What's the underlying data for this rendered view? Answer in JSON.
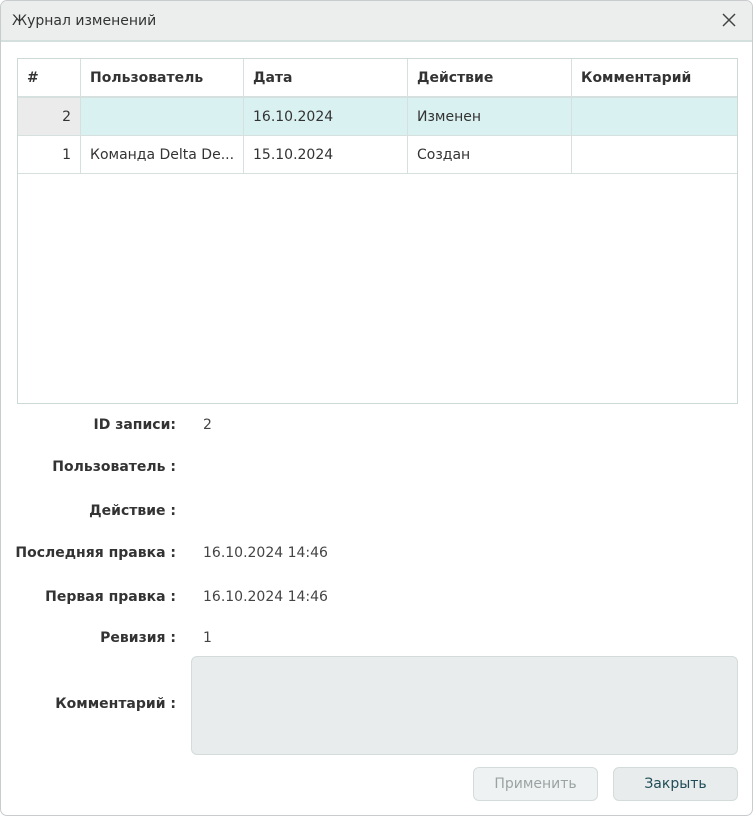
{
  "window": {
    "title": "Журнал изменений"
  },
  "table": {
    "columns": [
      "#",
      "Пользователь",
      "Дата",
      "Действие",
      "Комментарий"
    ],
    "rows": [
      {
        "num": "2",
        "user": "",
        "date": "16.10.2024",
        "action": "Изменен",
        "comment": "",
        "selected": true
      },
      {
        "num": "1",
        "user": "Команда Delta De...",
        "date": "15.10.2024",
        "action": "Создан",
        "comment": "",
        "selected": false
      }
    ]
  },
  "details": {
    "id_label": "ID записи:",
    "id_value": "2",
    "user_label": "Пользователь :",
    "user_value": "",
    "action_label": "Действие :",
    "action_value": "",
    "last_label": "Последняя правка :",
    "last_value": "16.10.2024 14:46",
    "first_label": "Первая правка :",
    "first_value": "16.10.2024 14:46",
    "rev_label": "Ревизия :",
    "rev_value": "1",
    "comment_label": "Комментарий :",
    "comment_value": ""
  },
  "buttons": {
    "apply": "Применить",
    "close": "Закрыть"
  }
}
